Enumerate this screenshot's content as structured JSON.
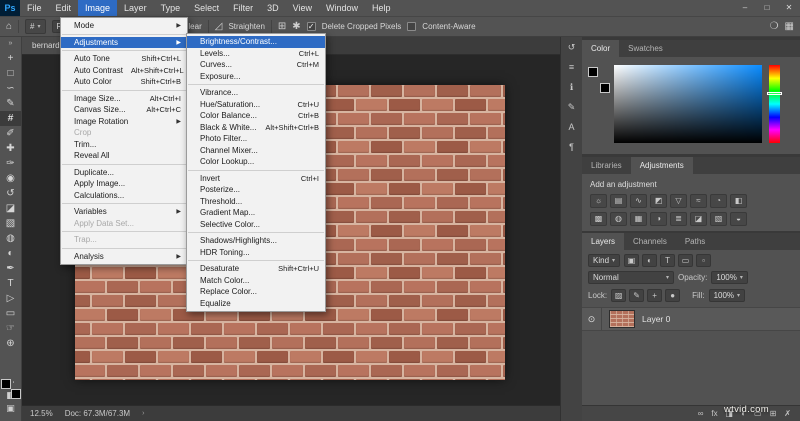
{
  "menubar": {
    "logo": "Ps",
    "items": [
      "File",
      "Edit",
      "Image",
      "Layer",
      "Type",
      "Select",
      "Filter",
      "3D",
      "View",
      "Window",
      "Help"
    ],
    "active": "Image",
    "window_controls": [
      {
        "name": "minimize-button",
        "glyph": "–"
      },
      {
        "name": "maximize-button",
        "glyph": "□"
      },
      {
        "name": "close-button",
        "glyph": "✕"
      }
    ]
  },
  "options_bar": {
    "home_icon": "⌂",
    "crop_icon": "#",
    "tool_caret": "▾",
    "ratio_label": "Ratio",
    "swap_icon": "⇄",
    "clear_label": "Clear",
    "straighten_icon": "◿",
    "straighten_label": "Straighten",
    "overlay_icon": "⊞",
    "gear_icon": "✱",
    "delete_cropped_label": "Delete Cropped Pixels",
    "delete_cropped_checked": true,
    "content_aware_label": "Content-Aware",
    "content_aware_checked": false,
    "search_icon": "❍",
    "workspace_icon": "▦"
  },
  "document_tab": {
    "title": "bernard-he..."
  },
  "toolbar": {
    "collapse_icon": "»",
    "tools": [
      {
        "name": "move-tool",
        "glyph": "+"
      },
      {
        "name": "rectangular-marquee-tool",
        "glyph": "□"
      },
      {
        "name": "lasso-tool",
        "glyph": "∽"
      },
      {
        "name": "quick-selection-tool",
        "glyph": "✎"
      },
      {
        "name": "crop-tool",
        "glyph": "#",
        "selected": true
      },
      {
        "name": "eyedropper-tool",
        "glyph": "✐"
      },
      {
        "name": "spot-healing-brush-tool",
        "glyph": "✚"
      },
      {
        "name": "brush-tool",
        "glyph": "✑"
      },
      {
        "name": "clone-stamp-tool",
        "glyph": "◉"
      },
      {
        "name": "history-brush-tool",
        "glyph": "↺"
      },
      {
        "name": "eraser-tool",
        "glyph": "◪"
      },
      {
        "name": "gradient-tool",
        "glyph": "▧"
      },
      {
        "name": "blur-tool",
        "glyph": "◍"
      },
      {
        "name": "dodge-tool",
        "glyph": "◐"
      },
      {
        "name": "pen-tool",
        "glyph": "✒"
      },
      {
        "name": "type-tool",
        "glyph": "T"
      },
      {
        "name": "path-selection-tool",
        "glyph": "▷"
      },
      {
        "name": "rectangle-tool",
        "glyph": "▭"
      },
      {
        "name": "hand-tool",
        "glyph": "☞"
      },
      {
        "name": "zoom-tool",
        "glyph": "⊕"
      }
    ],
    "edit_toolbar_icon": "⋯",
    "quick_mask_icon": "◧",
    "screen_mode_icon": "▣"
  },
  "image_menu": {
    "items": [
      {
        "label": "Mode",
        "submenu": true
      },
      {
        "sep": true
      },
      {
        "label": "Adjustments",
        "submenu": true,
        "highlighted": true
      },
      {
        "sep": true
      },
      {
        "label": "Auto Tone",
        "shortcut": "Shift+Ctrl+L"
      },
      {
        "label": "Auto Contrast",
        "shortcut": "Alt+Shift+Ctrl+L"
      },
      {
        "label": "Auto Color",
        "shortcut": "Shift+Ctrl+B"
      },
      {
        "sep": true
      },
      {
        "label": "Image Size...",
        "shortcut": "Alt+Ctrl+I"
      },
      {
        "label": "Canvas Size...",
        "shortcut": "Alt+Ctrl+C"
      },
      {
        "label": "Image Rotation",
        "submenu": true
      },
      {
        "label": "Crop",
        "disabled": true
      },
      {
        "label": "Trim..."
      },
      {
        "label": "Reveal All"
      },
      {
        "sep": true
      },
      {
        "label": "Duplicate..."
      },
      {
        "label": "Apply Image..."
      },
      {
        "label": "Calculations..."
      },
      {
        "sep": true
      },
      {
        "label": "Variables",
        "submenu": true
      },
      {
        "label": "Apply Data Set...",
        "disabled": true
      },
      {
        "sep": true
      },
      {
        "label": "Trap...",
        "disabled": true
      },
      {
        "sep": true
      },
      {
        "label": "Analysis",
        "submenu": true
      }
    ]
  },
  "adjustments_menu": {
    "items": [
      {
        "label": "Brightness/Contrast...",
        "highlighted": true
      },
      {
        "label": "Levels...",
        "shortcut": "Ctrl+L"
      },
      {
        "label": "Curves...",
        "shortcut": "Ctrl+M"
      },
      {
        "label": "Exposure..."
      },
      {
        "sep": true
      },
      {
        "label": "Vibrance..."
      },
      {
        "label": "Hue/Saturation...",
        "shortcut": "Ctrl+U"
      },
      {
        "label": "Color Balance...",
        "shortcut": "Ctrl+B"
      },
      {
        "label": "Black & White...",
        "shortcut": "Alt+Shift+Ctrl+B"
      },
      {
        "label": "Photo Filter..."
      },
      {
        "label": "Channel Mixer..."
      },
      {
        "label": "Color Lookup..."
      },
      {
        "sep": true
      },
      {
        "label": "Invert",
        "shortcut": "Ctrl+I"
      },
      {
        "label": "Posterize..."
      },
      {
        "label": "Threshold..."
      },
      {
        "label": "Gradient Map..."
      },
      {
        "label": "Selective Color..."
      },
      {
        "sep": true
      },
      {
        "label": "Shadows/Highlights..."
      },
      {
        "label": "HDR Toning..."
      },
      {
        "sep": true
      },
      {
        "label": "Desaturate",
        "shortcut": "Shift+Ctrl+U"
      },
      {
        "label": "Match Color..."
      },
      {
        "label": "Replace Color..."
      },
      {
        "label": "Equalize"
      }
    ]
  },
  "side_strip": {
    "icons": [
      {
        "name": "history-panel-icon",
        "glyph": "↺"
      },
      {
        "name": "properties-panel-icon",
        "glyph": "≡"
      },
      {
        "name": "info-panel-icon",
        "glyph": "ℹ"
      },
      {
        "name": "brushes-panel-icon",
        "glyph": "✎"
      },
      {
        "name": "character-panel-icon",
        "glyph": "A"
      },
      {
        "name": "paragraph-panel-icon",
        "glyph": "¶"
      }
    ]
  },
  "color_panel": {
    "tabs": [
      "Color",
      "Swatches"
    ],
    "active_tab": "Color",
    "picker_color": "#0a8cff"
  },
  "adjustments_panel": {
    "tabs": [
      "Libraries",
      "Adjustments"
    ],
    "active_tab": "Adjustments",
    "add_label": "Add an adjustment",
    "icons_row1": [
      {
        "name": "brightness-contrast-adjustment-icon",
        "glyph": "☼"
      },
      {
        "name": "levels-adjustment-icon",
        "glyph": "▤"
      },
      {
        "name": "curves-adjustment-icon",
        "glyph": "∿"
      },
      {
        "name": "exposure-adjustment-icon",
        "glyph": "◩"
      },
      {
        "name": "vibrance-adjustment-icon",
        "glyph": "▽"
      },
      {
        "name": "hue-saturation-adjustment-icon",
        "glyph": "≈"
      },
      {
        "name": "color-balance-adjustment-icon",
        "glyph": "◔"
      },
      {
        "name": "black-white-adjustment-icon",
        "glyph": "◧"
      }
    ],
    "icons_row2": [
      {
        "name": "photo-filter-adjustment-icon",
        "glyph": "▩"
      },
      {
        "name": "channel-mixer-adjustment-icon",
        "glyph": "◍"
      },
      {
        "name": "color-lookup-adjustment-icon",
        "glyph": "▦"
      },
      {
        "name": "invert-adjustment-icon",
        "glyph": "◑"
      },
      {
        "name": "posterize-adjustment-icon",
        "glyph": "≣"
      },
      {
        "name": "threshold-adjustment-icon",
        "glyph": "◪"
      },
      {
        "name": "selective-color-adjustment-icon",
        "glyph": "▧"
      },
      {
        "name": "gradient-map-adjustment-icon",
        "glyph": "◒"
      }
    ]
  },
  "layers_panel": {
    "tabs": [
      "Layers",
      "Channels",
      "Paths"
    ],
    "active_tab": "Layers",
    "kind_label": "Kind",
    "filter_icons": [
      {
        "name": "filter-pixel-layers-icon",
        "glyph": "▣"
      },
      {
        "name": "filter-adjustment-layers-icon",
        "glyph": "◐"
      },
      {
        "name": "filter-type-layers-icon",
        "glyph": "T"
      },
      {
        "name": "filter-shape-layers-icon",
        "glyph": "▭"
      },
      {
        "name": "filter-smart-objects-icon",
        "glyph": "▫"
      }
    ],
    "blend_mode": "Normal",
    "opacity_label": "Opacity:",
    "opacity_value": "100%",
    "lock_label": "Lock:",
    "lock_icons": [
      {
        "name": "lock-transparency-icon",
        "glyph": "▨"
      },
      {
        "name": "lock-image-icon",
        "glyph": "✎"
      },
      {
        "name": "lock-position-icon",
        "glyph": "+"
      },
      {
        "name": "lock-all-icon",
        "glyph": "●"
      }
    ],
    "fill_label": "Fill:",
    "fill_value": "100%",
    "eye_icon": "⊙",
    "layer_name": "Layer 0",
    "bottom_icons": [
      {
        "name": "link-layers-icon",
        "glyph": "∞"
      },
      {
        "name": "layer-effects-icon",
        "glyph": "fx"
      },
      {
        "name": "add-mask-icon",
        "glyph": "◨"
      },
      {
        "name": "new-adjustment-layer-icon",
        "glyph": "◐"
      },
      {
        "name": "new-group-icon",
        "glyph": "▭"
      },
      {
        "name": "new-layer-icon",
        "glyph": "⊞"
      },
      {
        "name": "delete-layer-icon",
        "glyph": "✗"
      }
    ]
  },
  "status_bar": {
    "zoom": "12.5%",
    "doc_info": "Doc: 67.3M/67.3M",
    "chevron_icon": "›"
  },
  "watermark": "wtvid.com",
  "brick_palette": [
    "#b3705b",
    "#aa6753",
    "#bd7a63",
    "#a05f4b",
    "#b8735e",
    "#9c5a46"
  ],
  "mortar_color": "#d7b4a0"
}
